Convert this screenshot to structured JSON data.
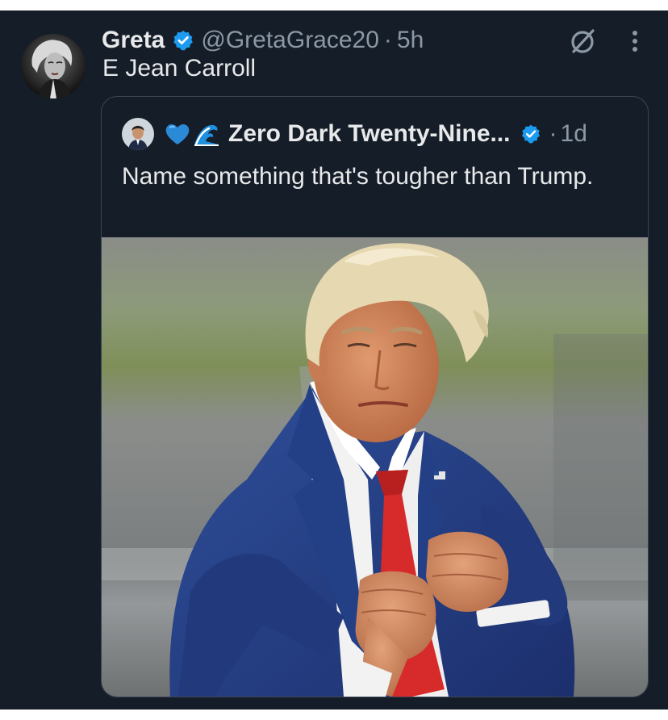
{
  "tweet": {
    "author_name": "Greta",
    "handle": "@GretaGrace20",
    "separator": "·",
    "time": "5h",
    "text": "E Jean Carroll",
    "avatar_icon": "portrait-photo"
  },
  "quoted_tweet": {
    "author_name": "Zero Dark Twenty-Nine...",
    "emojis": [
      "blue-heart",
      "water-wave"
    ],
    "separator": "·",
    "time": "1d",
    "text": "Name something that's tougher than Trump.",
    "photo_icon": "photo-man-in-blue-suit-fists-raised"
  },
  "icons": {
    "verified": "verified-badge-icon",
    "grok": "grok-icon",
    "more": "more-options-icon"
  },
  "colors": {
    "background": "#151d28",
    "text_primary": "#e7e9ea",
    "text_secondary": "#8b98a5",
    "verified_blue": "#1d9bf0",
    "card_border": "#3b4652"
  }
}
